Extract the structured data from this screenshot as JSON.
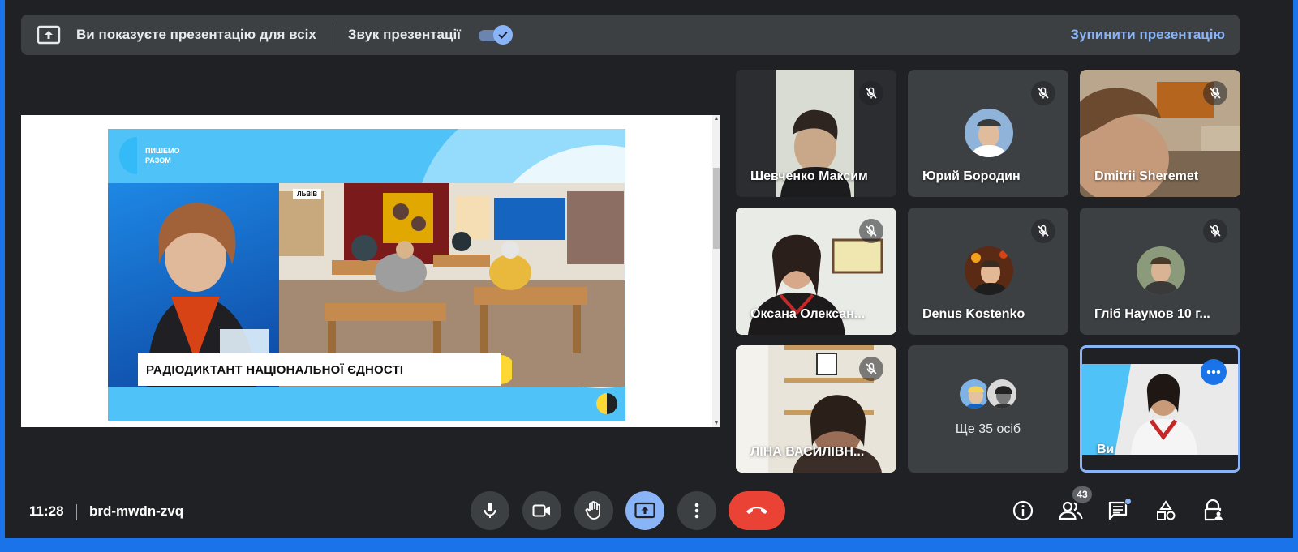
{
  "banner": {
    "message": "Ви показуєте презентацію для всіх",
    "audio_label": "Звук презентації",
    "audio_on": true,
    "stop_label": "Зупинити презентацію"
  },
  "slide": {
    "logo_text": "ПИШЕМО РАЗОМ",
    "city_tag": "ЛЬВІВ",
    "caption": "РАДІОДИКТАНТ НАЦІОНАЛЬНОЇ ЄДНОСТІ"
  },
  "participants": [
    {
      "name": "Шевченко Максим",
      "muted": true
    },
    {
      "name": "Юрий Бородин",
      "muted": true
    },
    {
      "name": "Dmitrii Sheremet",
      "muted": true
    },
    {
      "name": "Оксана Олексан...",
      "muted": true
    },
    {
      "name": "Denus Kostenko",
      "muted": true
    },
    {
      "name": "Гліб Наумов 10 г...",
      "muted": true
    },
    {
      "name": "ЛІНА ВАСИЛІВН...",
      "muted": true
    }
  ],
  "more_tile": {
    "label": "Ще 35 осіб"
  },
  "self_tile": {
    "name": "Ви"
  },
  "bottom": {
    "time": "11:28",
    "meeting_code": "brd-mwdn-zvq",
    "participant_count": "43"
  },
  "colors": {
    "background": "#202124",
    "tile": "#3c4043",
    "accent": "#8ab4f8",
    "end_call": "#ea4335"
  }
}
